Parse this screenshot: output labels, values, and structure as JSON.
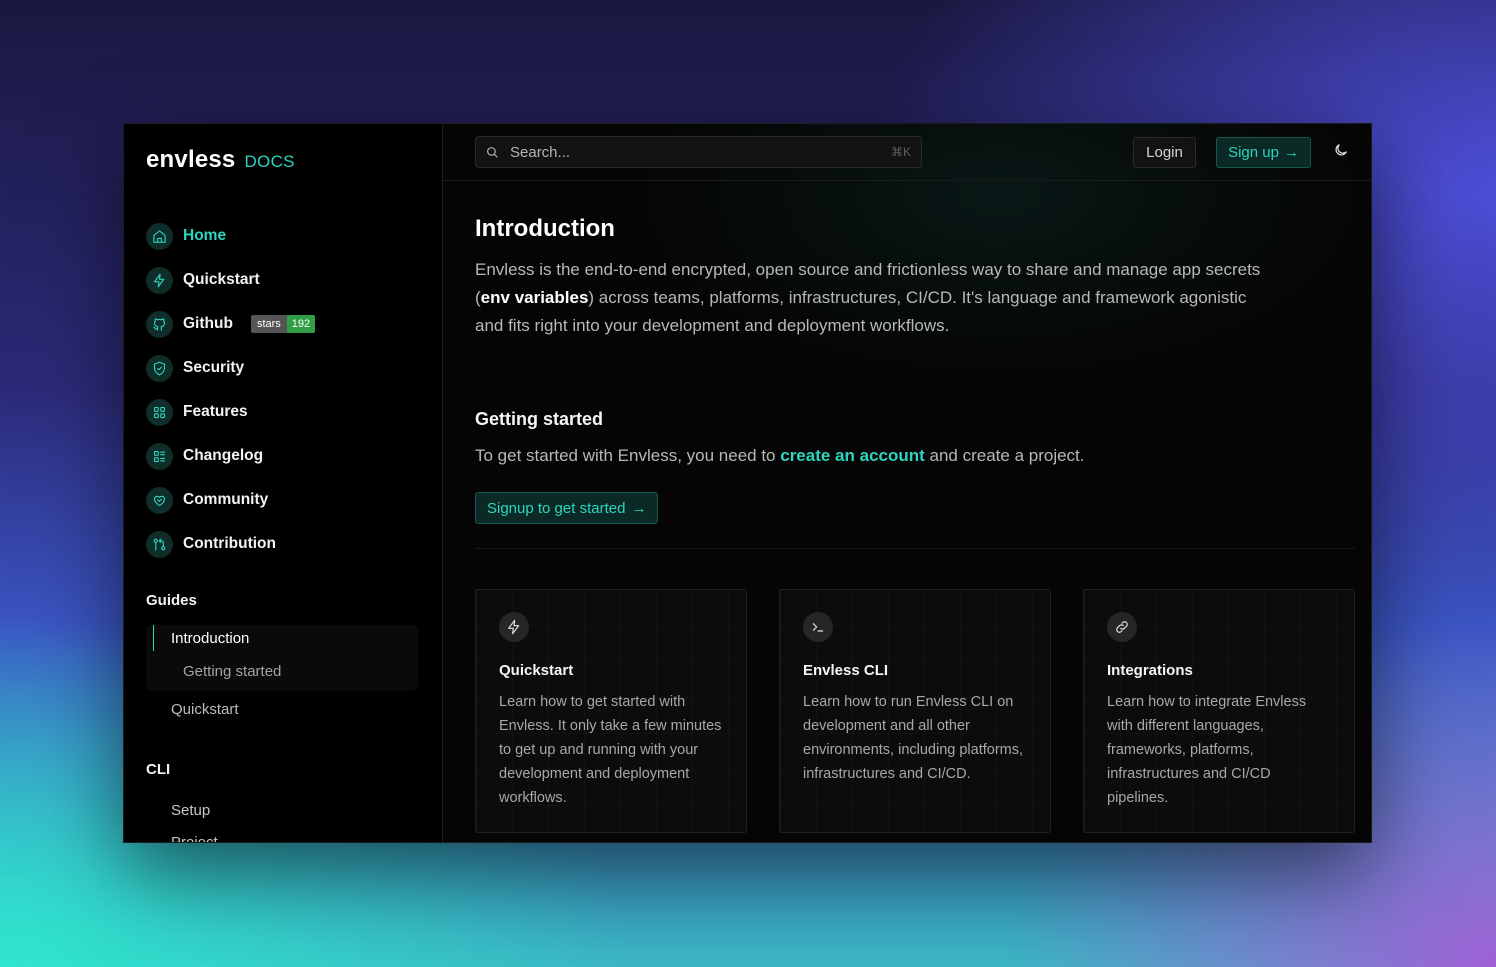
{
  "sidebar": {
    "logo": "envless",
    "logo_suffix": "DOCS",
    "nav": [
      {
        "label": "Home",
        "icon": "home-icon"
      },
      {
        "label": "Quickstart",
        "icon": "bolt-icon"
      },
      {
        "label": "Github",
        "icon": "github-icon",
        "badge_label": "stars",
        "badge_value": "192"
      },
      {
        "label": "Security",
        "icon": "shield-icon"
      },
      {
        "label": "Features",
        "icon": "grid-icon"
      },
      {
        "label": "Changelog",
        "icon": "list-icon"
      },
      {
        "label": "Community",
        "icon": "heart-icon"
      },
      {
        "label": "Contribution",
        "icon": "git-pull-icon"
      }
    ],
    "guides": {
      "title": "Guides",
      "items": [
        "Introduction",
        "Getting started",
        "Quickstart"
      ]
    },
    "cli": {
      "title": "CLI",
      "items": [
        "Setup",
        "Project"
      ]
    }
  },
  "topbar": {
    "search_placeholder": "Search...",
    "search_shortcut": "⌘K",
    "login": "Login",
    "signup": "Sign up",
    "signup_arrow": "→"
  },
  "content": {
    "title": "Introduction",
    "lead_1": "Envless is the end-to-end encrypted, open source and frictionless way to share and manage app secrets (",
    "lead_strong": "env variables",
    "lead_2": ") across teams, platforms, infrastructures, CI/CD. It's language and framework agonistic and fits right into your development and deployment workflows.",
    "section_title": "Getting started",
    "getting_started_1": "To get started with Envless, you need to ",
    "getting_started_link": "create an account",
    "getting_started_2": " and create a project.",
    "cta": "Signup to get started",
    "cta_arrow": "→"
  },
  "cards": [
    {
      "title": "Quickstart",
      "icon": "bolt-icon",
      "desc": "Learn how to get started with Envless. It only take a few minutes to get up and running with your development and deployment workflows."
    },
    {
      "title": "Envless CLI",
      "icon": "terminal-icon",
      "desc": "Learn how to run Envless CLI on development and all other environments, including platforms, infrastructures and CI/CD."
    },
    {
      "title": "Integrations",
      "icon": "link-icon",
      "desc": "Learn how to integrate Envless with different languages, frameworks, platforms, infrastructures and CI/CD pipelines."
    }
  ],
  "colors": {
    "accent": "#2dd4bf",
    "background": "#050505"
  }
}
